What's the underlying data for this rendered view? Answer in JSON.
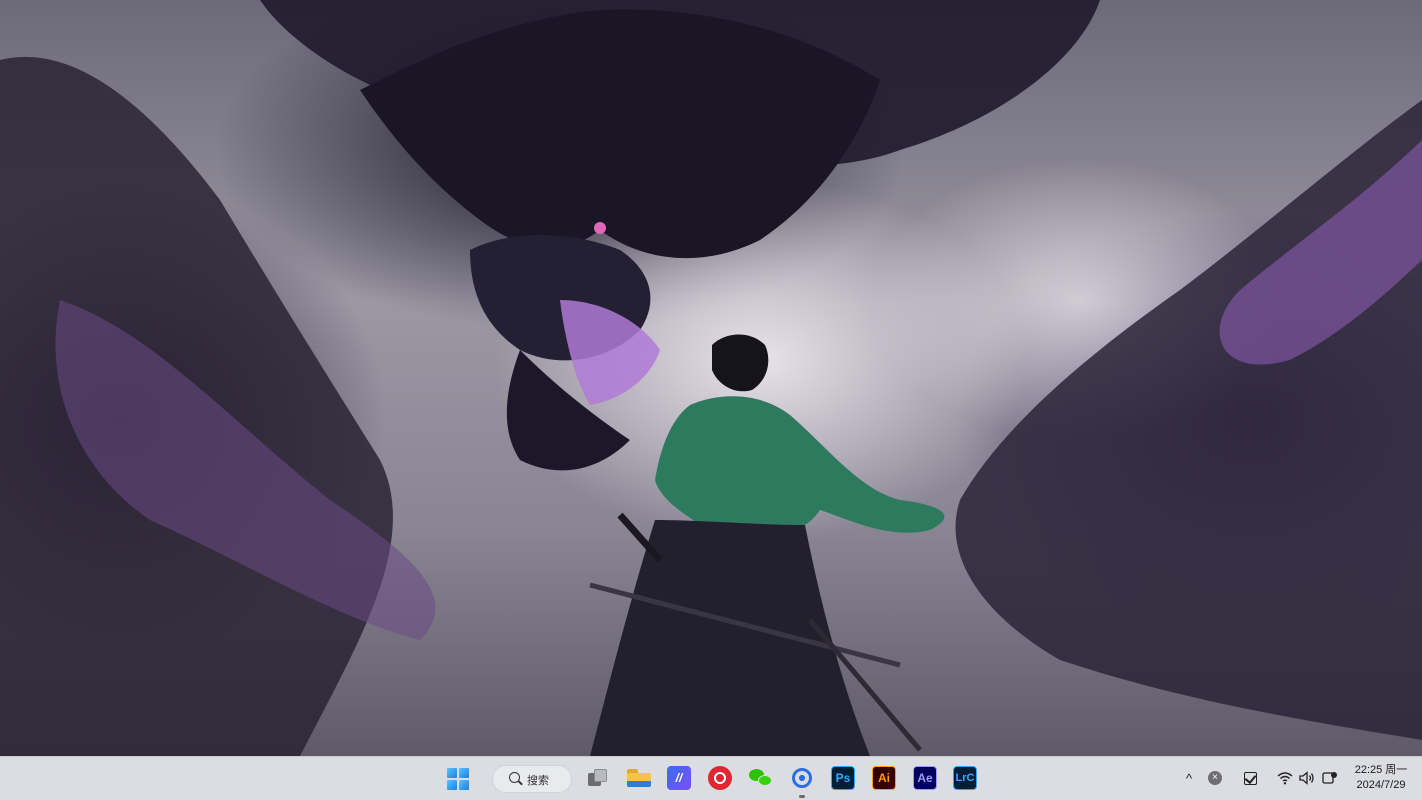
{
  "wallpaper": {
    "subject": "dragon-and-swordsman",
    "colors": {
      "sky": "#e8e2ea",
      "storm": "#2b2438",
      "purple": "#7b4fa0",
      "robe": "#2e7a5f",
      "pink": "#c776d6"
    }
  },
  "taskbar": {
    "background": "#dcdde2",
    "start": {
      "icon": "windows-logo"
    },
    "search": {
      "label": "搜索",
      "icon": "search-icon"
    },
    "apps": [
      {
        "name": "task-view",
        "icon": "task-view-icon",
        "label": ""
      },
      {
        "name": "file-explorer",
        "icon": "folder-icon",
        "label": ""
      },
      {
        "name": "app-m",
        "icon": "m-app-icon",
        "label": ""
      },
      {
        "name": "netease-music",
        "icon": "netease-music-icon",
        "label": ""
      },
      {
        "name": "wechat",
        "icon": "wechat-icon",
        "label": ""
      },
      {
        "name": "app-blue-circle",
        "icon": "blue-circle-app-icon",
        "label": ""
      },
      {
        "name": "photoshop",
        "icon": "photoshop-icon",
        "label": "Ps"
      },
      {
        "name": "illustrator",
        "icon": "illustrator-icon",
        "label": "Ai"
      },
      {
        "name": "after-effects",
        "icon": "after-effects-icon",
        "label": "Ae"
      },
      {
        "name": "lightroom-classic",
        "icon": "lightroom-classic-icon",
        "label": "LrC"
      }
    ],
    "tray": {
      "chevron": "^",
      "icons": [
        "close-circle-icon",
        "checkbox-icon",
        "wifi-icon",
        "volume-icon",
        "notification-icon"
      ]
    },
    "clock": {
      "time": "22:25 周一",
      "date": "2024/7/29"
    }
  }
}
